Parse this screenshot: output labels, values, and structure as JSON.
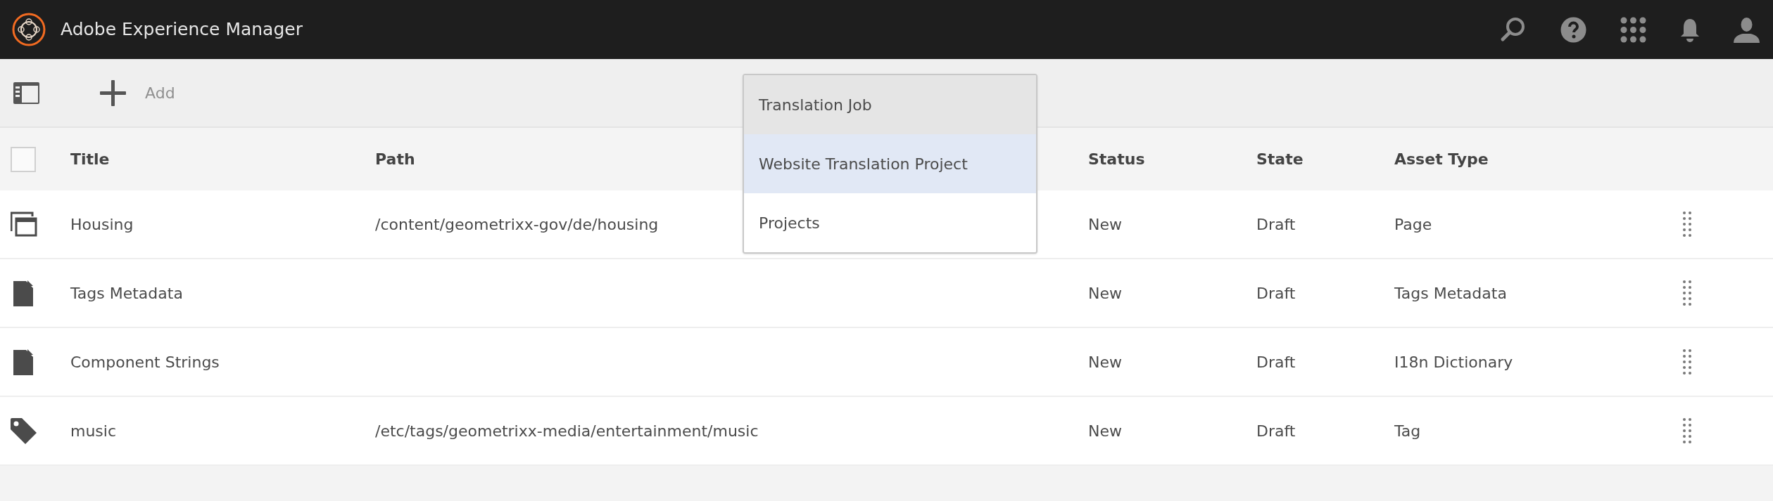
{
  "header": {
    "title": "Adobe Experience Manager"
  },
  "toolbar": {
    "add_label": "Add"
  },
  "menu": [
    {
      "label": "Translation Job",
      "selected": false,
      "hovered": true
    },
    {
      "label": "Website Translation Project",
      "selected": true,
      "hovered": false
    },
    {
      "label": "Projects",
      "selected": false,
      "hovered": false
    }
  ],
  "table": {
    "select_all": {
      "checked": false
    },
    "columns": [
      "Title",
      "Path",
      "Status",
      "State",
      "Asset Type"
    ],
    "rows": [
      {
        "kind": "page",
        "title": "Housing",
        "path": "/content/geometrixx-gov/de/housing",
        "status": "New",
        "state": "Draft",
        "asset_type": "Page"
      },
      {
        "kind": "file",
        "title": "Tags Metadata",
        "path": "",
        "status": "New",
        "state": "Draft",
        "asset_type": "Tags Metadata"
      },
      {
        "kind": "file",
        "title": "Component Strings",
        "path": "",
        "status": "New",
        "state": "Draft",
        "asset_type": "I18n Dictionary"
      },
      {
        "kind": "tag",
        "title": "music",
        "path": "/etc/tags/geometrixx-media/entertainment/music",
        "status": "New",
        "state": "Draft",
        "asset_type": "Tag"
      }
    ]
  }
}
